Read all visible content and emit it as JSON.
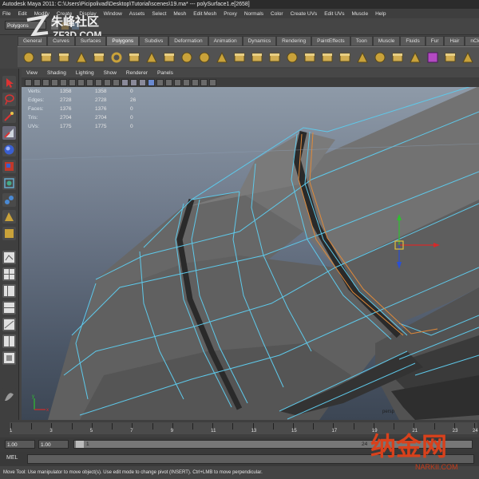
{
  "window": {
    "title": "Autodesk Maya 2011: C:\\Users\\Picipolivad\\Desktop\\Tutorial\\scenes\\19.ma*  ---  polySurface1.e[2658]"
  },
  "menubar": [
    "File",
    "Edit",
    "Modify",
    "Create",
    "Display",
    "Window",
    "Assets",
    "Select",
    "Mesh",
    "Edit Mesh",
    "Proxy",
    "Normals",
    "Color",
    "Create UVs",
    "Edit UVs",
    "Muscle",
    "Help"
  ],
  "status_line": {
    "mode": "Polygons"
  },
  "shelf": {
    "tabs": [
      "General",
      "Curves",
      "Surfaces",
      "Polygons",
      "Subdivs",
      "Deformation",
      "Animation",
      "Dynamics",
      "Rendering",
      "PaintEffects",
      "Toon",
      "Muscle",
      "Fluids",
      "Fur",
      "Hair",
      "nCloth"
    ],
    "active_tab": "Polygons"
  },
  "panel": {
    "menus": [
      "View",
      "Shading",
      "Lighting",
      "Show",
      "Renderer",
      "Panels"
    ]
  },
  "hud": {
    "rows": [
      {
        "label": "Verts:",
        "v1": "1358",
        "v2": "1358",
        "v3": "0"
      },
      {
        "label": "Edges:",
        "v1": "2728",
        "v2": "2728",
        "v3": "26"
      },
      {
        "label": "Faces:",
        "v1": "1376",
        "v2": "1376",
        "v3": "0"
      },
      {
        "label": "Tris:",
        "v1": "2704",
        "v2": "2704",
        "v3": "0"
      },
      {
        "label": "UVs:",
        "v1": "1775",
        "v2": "1775",
        "v3": "0"
      }
    ]
  },
  "viewport": {
    "camera_label": "persp"
  },
  "timeline": {
    "ticks": [
      "1",
      "2",
      "3",
      "4",
      "5",
      "6",
      "7",
      "8",
      "9",
      "10",
      "11",
      "12",
      "13",
      "14",
      "15",
      "16",
      "17",
      "18",
      "19",
      "20",
      "21",
      "22",
      "23",
      "24"
    ]
  },
  "range": {
    "start": "1.00",
    "playback_start": "1.00",
    "range_start": "1",
    "range_end": "24"
  },
  "command_line": {
    "label": "MEL"
  },
  "help_line": {
    "text": "Move Tool: Use manipulator to move object(s). Use edit mode to change pivot (INSERT). Ctrl+LMB to move perpendicular."
  },
  "watermarks": {
    "top_left": "朱峰社区 ZF3D.COM",
    "bottom_right": "纳金网 NARKII.COM"
  },
  "colors": {
    "wire": "#5ec9ea",
    "selected_edge": "#e08a3a",
    "mesh": "#6b6b6b",
    "move_x": "#d42a2a",
    "move_y": "#2fbf2f",
    "move_z": "#2a4fd4"
  }
}
